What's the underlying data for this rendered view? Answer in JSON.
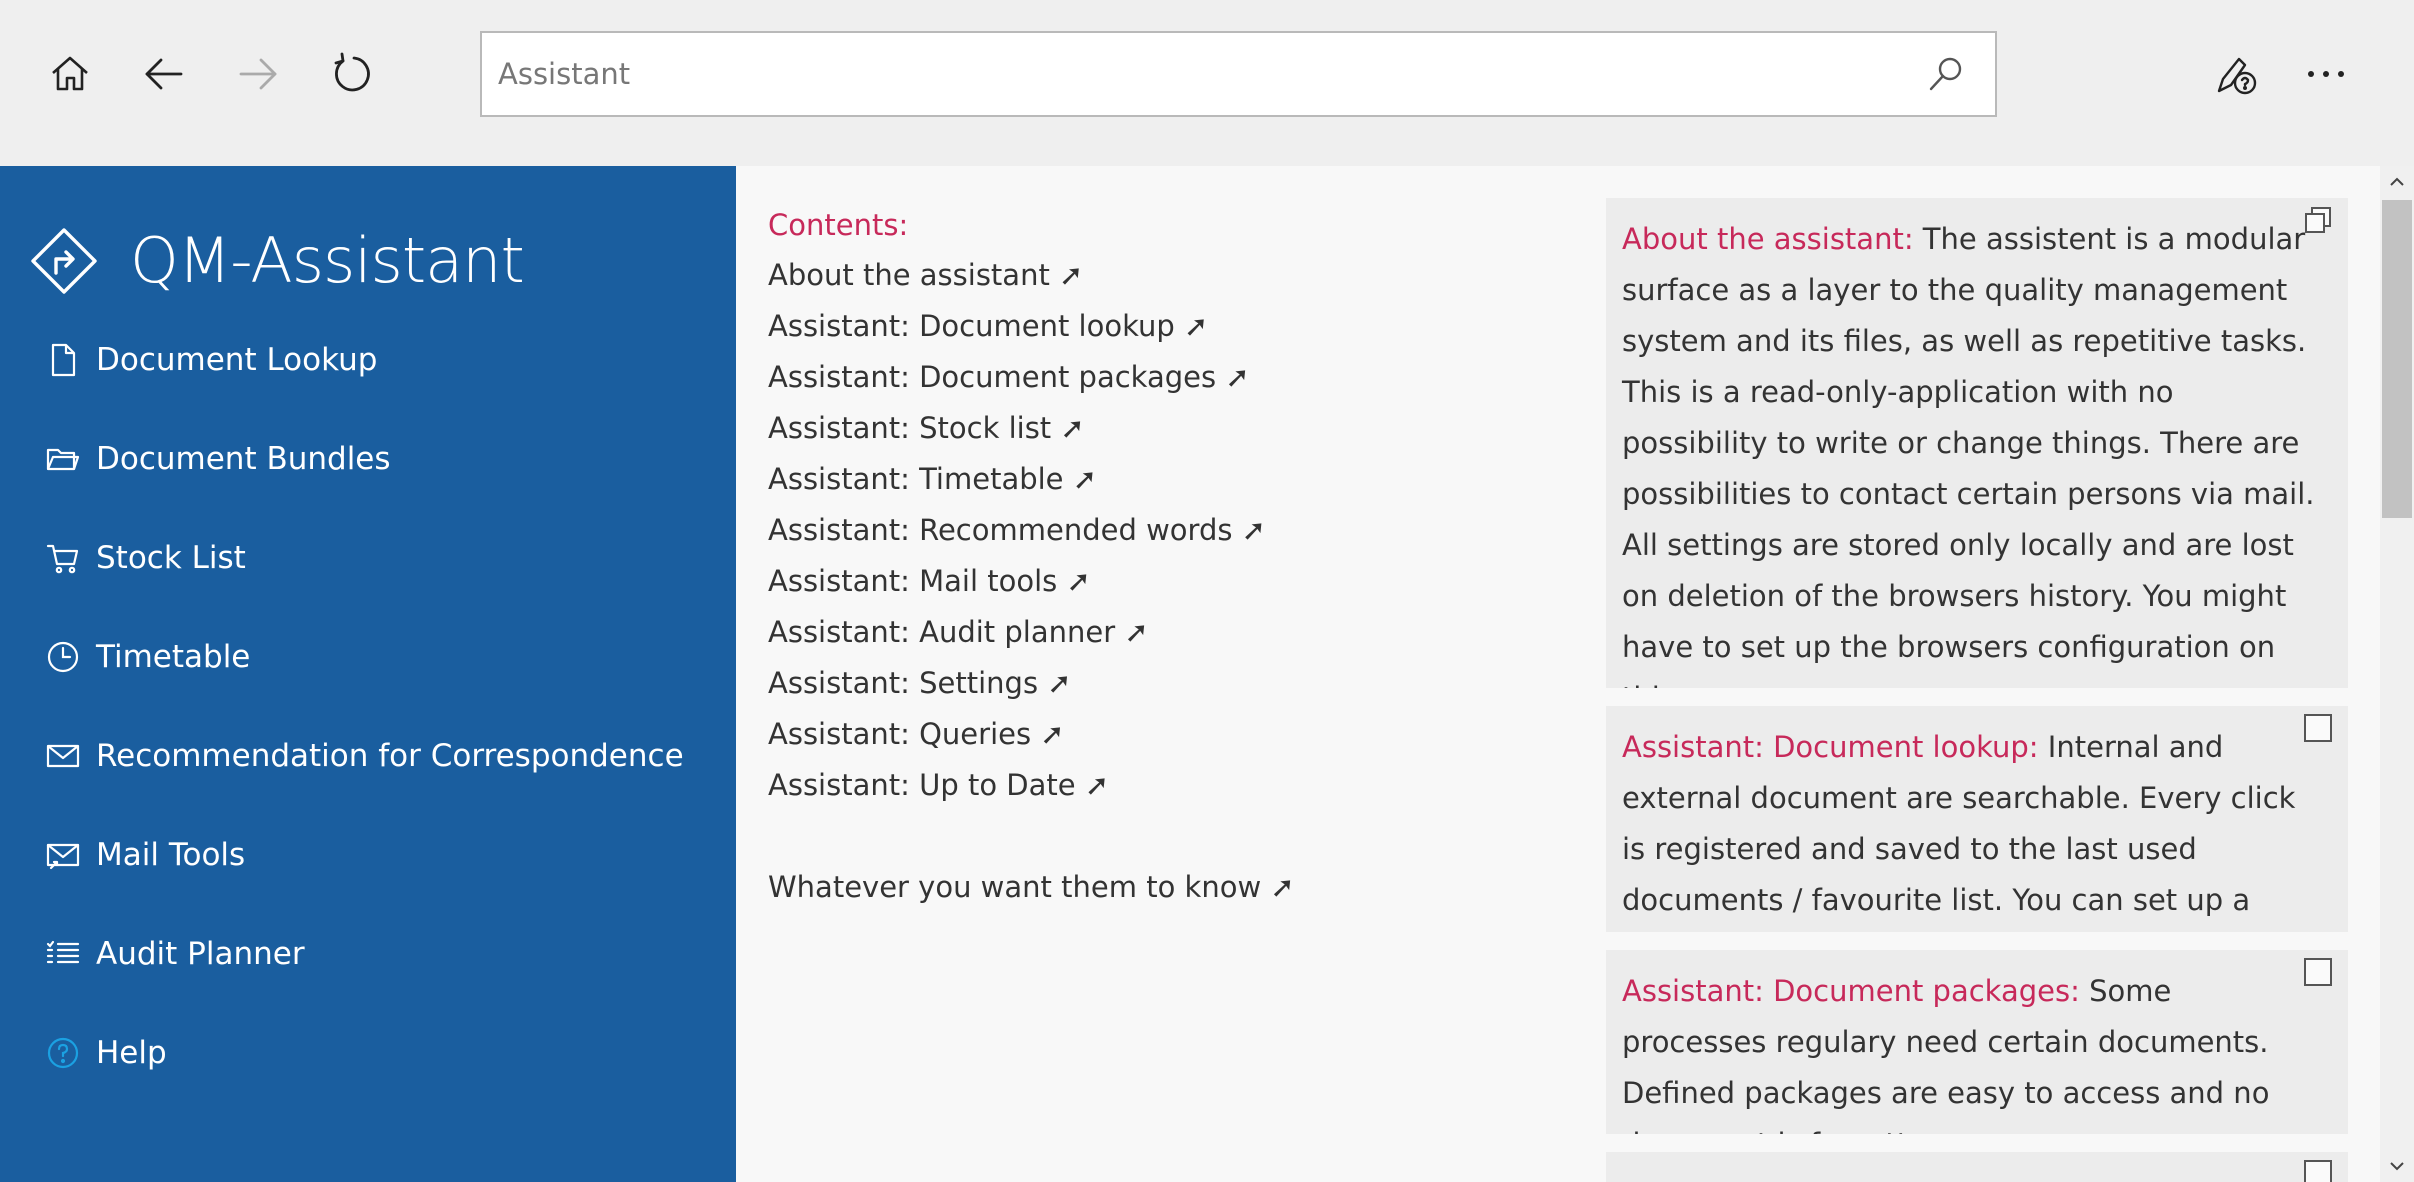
{
  "toolbar": {
    "icons": {
      "home": "home-icon",
      "back": "back-arrow-icon",
      "forward": "forward-arrow-icon",
      "refresh": "refresh-icon",
      "help": "help-pen-icon",
      "more": "more-icon"
    },
    "search": {
      "placeholder": "Assistant",
      "value": ""
    }
  },
  "sidebar": {
    "title": "QM-Assistant",
    "items": [
      {
        "label": "Document Lookup",
        "icon": "document-icon"
      },
      {
        "label": "Document Bundles",
        "icon": "folder-icon"
      },
      {
        "label": "Stock List",
        "icon": "cart-icon"
      },
      {
        "label": "Timetable",
        "icon": "clock-icon"
      },
      {
        "label": "Recommendation for Correspondence",
        "icon": "envelope-icon"
      },
      {
        "label": "Mail Tools",
        "icon": "mail-tools-icon"
      },
      {
        "label": "Audit Planner",
        "icon": "checklist-icon"
      },
      {
        "label": "Help",
        "icon": "help-icon"
      }
    ]
  },
  "contents": {
    "title": "Contents:",
    "links": [
      "About the assistant ➚",
      "Assistant: Document lookup ➚",
      "Assistant: Document packages ➚",
      "Assistant: Stock list ➚",
      "Assistant: Timetable ➚",
      "Assistant: Recommended words ➚",
      "Assistant: Mail tools ➚",
      "Assistant: Audit planner ➚",
      "Assistant: Settings ➚",
      "Assistant: Queries ➚",
      "Assistant: Up to Date ➚"
    ],
    "extra_link": "Whatever you want them to know ➚"
  },
  "articles": [
    {
      "heading": "About the assistant:",
      "body": " The assistent is a modular surface as a layer to the quality management system and its files, as well as repetitive tasks. This is a read-only-application with no possibility to write or change things. There are possibilities to contact certain persons via mail. All settings are stored only locally and are lost on deletion of the browsers history. You might have to set up the browsers configuration on this."
    },
    {
      "heading": "Assistant: Document lookup:",
      "body": " Internal and external document are searchable. Every click is registered and saved to the last used documents / favourite list. You can set up a favourite list for yourself and"
    },
    {
      "heading": "Assistant: Document packages:",
      "body": " Some processes regulary need certain documents. Defined packages are easy to access and no document is forgotten."
    },
    {
      "heading": "",
      "body": ""
    }
  ],
  "colors": {
    "sidebar": "#1a5e9f",
    "accent": "#c7295a",
    "help_icon": "#1ba1e2"
  }
}
